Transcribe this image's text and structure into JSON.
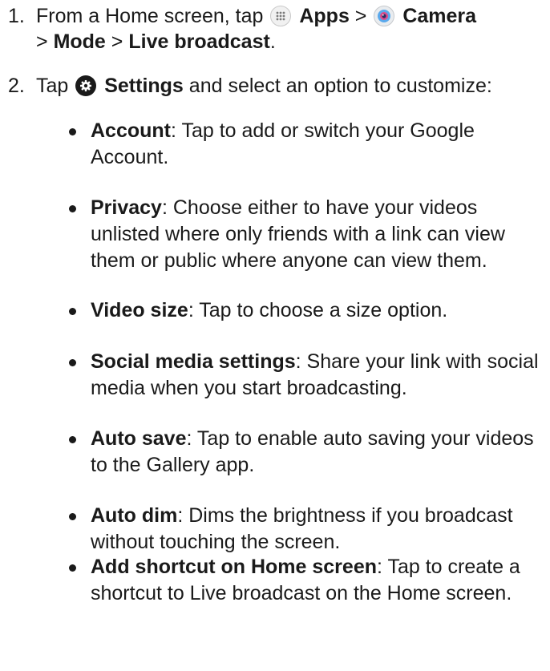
{
  "steps": [
    {
      "number": "1.",
      "text_from": "From a Home screen, tap",
      "apps": "Apps",
      "sep1": ">",
      "camera": "Camera",
      "sep2": ">",
      "mode": "Mode",
      "sep3": ">",
      "live": "Live broadcast",
      "end": "."
    },
    {
      "number": "2.",
      "text_tap": "Tap",
      "settings": "Settings",
      "text_rest": "and select an option to customize:"
    }
  ],
  "options": [
    {
      "name": "Account",
      "desc": ": Tap to add or switch your Google Account."
    },
    {
      "name": "Privacy",
      "desc": ": Choose either to have your videos unlisted where only friends with a link can view them or public where anyone can view them."
    },
    {
      "name": "Video size",
      "desc": ": Tap to choose a size option."
    },
    {
      "name": "Social media settings",
      "desc": ": Share your link with social media when you start broadcasting."
    },
    {
      "name": "Auto save",
      "desc": ": Tap to enable auto saving your videos to the Gallery app."
    },
    {
      "name": "Auto dim",
      "desc": ": Dims the brightness if you broadcast without touching the screen."
    },
    {
      "name": "Add shortcut on Home screen",
      "desc": ": Tap to create a shortcut to Live broadcast on the Home screen."
    }
  ],
  "icons": {
    "apps": "apps-icon",
    "camera": "camera-icon",
    "settings": "gear-icon"
  }
}
